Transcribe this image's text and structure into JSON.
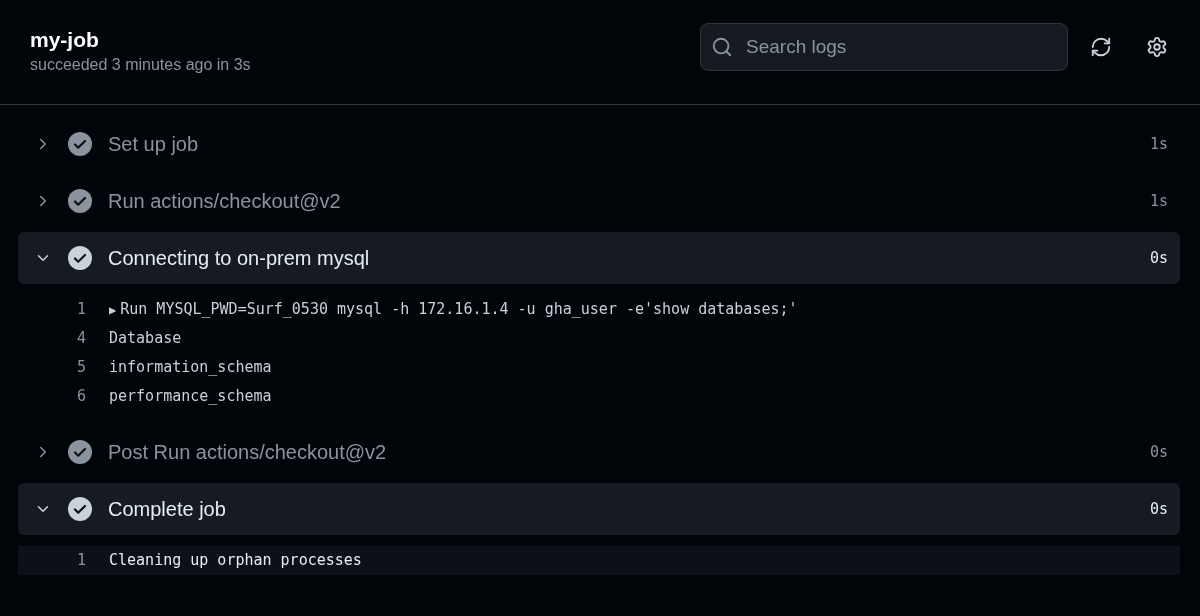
{
  "job": {
    "title": "my-job",
    "status": "succeeded 3 minutes ago in 3s"
  },
  "search": {
    "placeholder": "Search logs"
  },
  "steps": [
    {
      "name": "Set up job",
      "duration": "1s",
      "expanded": false
    },
    {
      "name": "Run actions/checkout@v2",
      "duration": "1s",
      "expanded": false
    },
    {
      "name": "Connecting to on-prem mysql",
      "duration": "0s",
      "expanded": true,
      "lines": [
        {
          "number": "1",
          "marker": "▶",
          "text": "Run MYSQL_PWD=Surf_0530 mysql -h 172.16.1.4 -u gha_user -e'show databases;'",
          "highlighted": false
        },
        {
          "number": "4",
          "text": "Database",
          "highlighted": false
        },
        {
          "number": "5",
          "text": "information_schema",
          "highlighted": false
        },
        {
          "number": "6",
          "text": "performance_schema",
          "highlighted": false
        }
      ]
    },
    {
      "name": "Post Run actions/checkout@v2",
      "duration": "0s",
      "expanded": false
    },
    {
      "name": "Complete job",
      "duration": "0s",
      "expanded": true,
      "lines": [
        {
          "number": "1",
          "text": "Cleaning up orphan processes",
          "highlighted": true
        }
      ]
    }
  ]
}
